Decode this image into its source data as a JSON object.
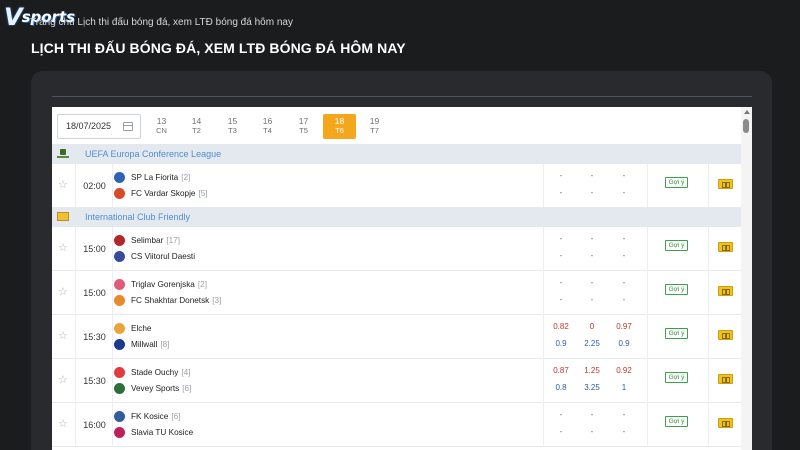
{
  "site": {
    "logo_v": "V",
    "logo_text": "sports"
  },
  "breadcrumb": "Trang chủ  Lịch thi đấu bóng đá, xem LTĐ bóng đá hôm nay",
  "page_title": "LỊCH THI ĐẤU BÓNG ĐÁ, XEM LTĐ BÓNG ĐÁ HÔM NAY",
  "date_picker": {
    "value": "18/07/2025"
  },
  "days": [
    {
      "date": "13",
      "dow": "CN",
      "active": false
    },
    {
      "date": "14",
      "dow": "T2",
      "active": false
    },
    {
      "date": "15",
      "dow": "T3",
      "active": false
    },
    {
      "date": "16",
      "dow": "T4",
      "active": false
    },
    {
      "date": "17",
      "dow": "T5",
      "active": false
    },
    {
      "date": "18",
      "dow": "T6",
      "active": true
    },
    {
      "date": "19",
      "dow": "T7",
      "active": false
    }
  ],
  "leagues": [
    {
      "name": "UEFA Europa Conference League",
      "flag": "europe-flag-icon"
    },
    {
      "name": "International Club Friendly",
      "flag": "world-flag-icon"
    }
  ],
  "tip_label": "Gợi ý",
  "matches": [
    {
      "time": "02:00",
      "home": {
        "name": "SP La Fiorita",
        "rank": "[2]",
        "crest_color": "#2f62b5"
      },
      "away": {
        "name": "FC Vardar Skopje",
        "rank": "[5]",
        "crest_color": "#d84a2a"
      },
      "odds_row1": [
        "-",
        "-",
        "-"
      ],
      "odds_row2": [
        "-",
        "-",
        "-"
      ]
    },
    {
      "time": "15:00",
      "home": {
        "name": "Selimbar",
        "rank": "[17]",
        "crest_color": "#b3262b"
      },
      "away": {
        "name": "CS Viitorul Daesti",
        "rank": "",
        "crest_color": "#3a4a9a"
      },
      "odds_row1": [
        "-",
        "-",
        "-"
      ],
      "odds_row2": [
        "-",
        "-",
        "-"
      ]
    },
    {
      "time": "15:00",
      "home": {
        "name": "Triglav Gorenjska",
        "rank": "[2]",
        "crest_color": "#e05a7a"
      },
      "away": {
        "name": "FC Shakhtar Donetsk",
        "rank": "[3]",
        "crest_color": "#e8892c"
      },
      "odds_row1": [
        "-",
        "-",
        "-"
      ],
      "odds_row2": [
        "-",
        "-",
        "-"
      ]
    },
    {
      "time": "15:30",
      "home": {
        "name": "Elche",
        "rank": "",
        "crest_color": "#e8a53c"
      },
      "away": {
        "name": "Millwall",
        "rank": "[8]",
        "crest_color": "#1b3a8c"
      },
      "odds_row1": [
        "0.82",
        "0",
        "0.97"
      ],
      "odds_row2": [
        "0.9",
        "2.25",
        "0.9"
      ]
    },
    {
      "time": "15:30",
      "home": {
        "name": "Stade Ouchy",
        "rank": "[4]",
        "crest_color": "#e23b3b"
      },
      "away": {
        "name": "Vevey Sports",
        "rank": "[6]",
        "crest_color": "#2e6e3a"
      },
      "odds_row1": [
        "0.87",
        "1.25",
        "0.92"
      ],
      "odds_row2": [
        "0.8",
        "3.25",
        "1"
      ]
    },
    {
      "time": "16:00",
      "home": {
        "name": "FK Kosice",
        "rank": "[6]",
        "crest_color": "#2f5d9e"
      },
      "away": {
        "name": "Slavia TU Kosice",
        "rank": "",
        "crest_color": "#c0205a"
      },
      "odds_row1": [
        "-",
        "-",
        "-"
      ],
      "odds_row2": [
        "-",
        "-",
        "-"
      ]
    }
  ],
  "colors": {
    "accent": "#f4a71d",
    "league_bg": "#e4e9ef",
    "league_text": "#4f8fd1",
    "odds_red": "#c0392b",
    "odds_blue": "#2a5f9e",
    "tip_green": "#2e8a3d"
  }
}
